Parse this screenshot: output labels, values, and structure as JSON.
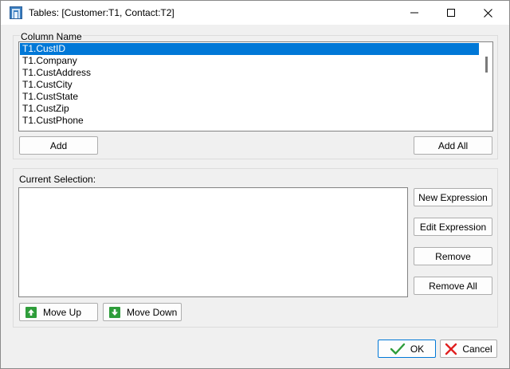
{
  "window": {
    "title": "Tables: [Customer:T1, Contact:T2]"
  },
  "column_group": {
    "label": "Column Name",
    "items": [
      {
        "label": "T1.CustID",
        "selected": true
      },
      {
        "label": "T1.Company",
        "selected": false
      },
      {
        "label": "T1.CustAddress",
        "selected": false
      },
      {
        "label": "T1.CustCity",
        "selected": false
      },
      {
        "label": "T1.CustState",
        "selected": false
      },
      {
        "label": "T1.CustZip",
        "selected": false
      },
      {
        "label": "T1.CustPhone",
        "selected": false
      }
    ],
    "add_label": "Add",
    "add_all_label": "Add All"
  },
  "selection_group": {
    "label": "Current Selection:",
    "new_expression_label": "New Expression",
    "edit_expression_label": "Edit Expression",
    "remove_label": "Remove",
    "remove_all_label": "Remove All",
    "move_up_label": "Move Up",
    "move_down_label": "Move Down"
  },
  "footer": {
    "ok_label": "OK",
    "cancel_label": "Cancel"
  },
  "colors": {
    "selection": "#0078d7",
    "move_icon": "#2e9d3a",
    "ok_check": "#2e9d3a",
    "cancel_x": "#e02020"
  },
  "icons": {
    "app": "table-app-icon",
    "move_up": "arrow-up-icon",
    "move_down": "arrow-down-icon",
    "ok": "check-icon",
    "cancel": "x-icon"
  }
}
